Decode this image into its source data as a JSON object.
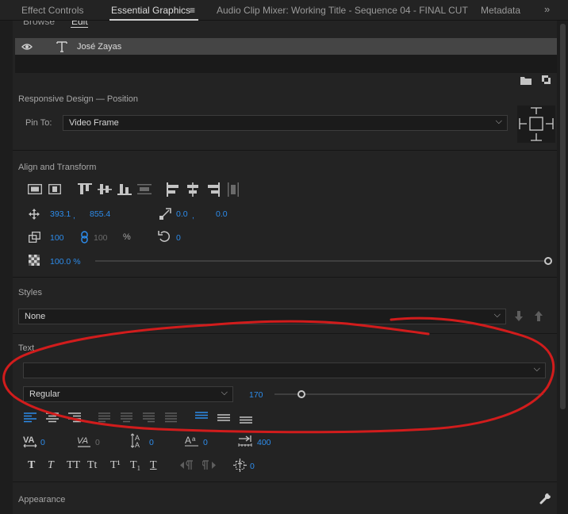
{
  "tabs": [
    {
      "label": "Effect Controls"
    },
    {
      "label": "Essential Graphics",
      "menu_glyph": "≡"
    },
    {
      "label": "Audio Clip Mixer: Working Title - Sequence 04 - FINAL CUT"
    },
    {
      "label": "Metadata"
    },
    {
      "label": "»"
    }
  ],
  "subtabs": [
    "Browse",
    "Edit"
  ],
  "layer": {
    "name": "José Zayas"
  },
  "responsive": {
    "title": "Responsive Design — Position",
    "pin_label": "Pin To:",
    "pin_value": "Video Frame"
  },
  "align": {
    "title": "Align and Transform",
    "pos_x": "393.1",
    "sep1": ",",
    "pos_y": "855.4",
    "anchor_x": "0.0",
    "sep2": ",",
    "anchor_y": "0.0",
    "scale": "100",
    "scale_linked": "100",
    "scale_unit": "%",
    "rotation": "0",
    "opacity": "100.0 %"
  },
  "styles": {
    "title": "Styles",
    "value": "None"
  },
  "text": {
    "title": "Text",
    "font": "",
    "font_style": "Regular",
    "font_size": "170",
    "kerning": "0",
    "tracking": "0",
    "leading": "0",
    "baseline": "0",
    "tab_width": "400",
    "tsume": "0",
    "caps_label": "TT",
    "smallcaps_label": "Tt",
    "super_label": "T¹",
    "sub_label": "T₁"
  },
  "appearance": {
    "title": "Appearance"
  },
  "annotation": {
    "color": "#d11c1c"
  }
}
